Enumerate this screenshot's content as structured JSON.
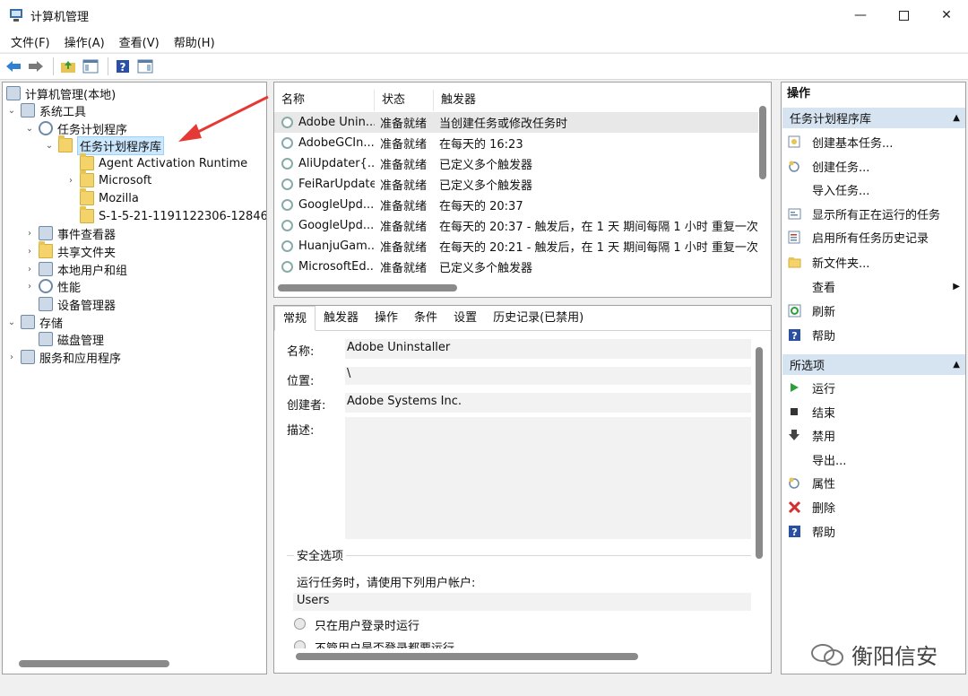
{
  "window": {
    "title": "计算机管理"
  },
  "menu": [
    "文件(F)",
    "操作(A)",
    "查看(V)",
    "帮助(H)"
  ],
  "tree": {
    "root": "计算机管理(本地)",
    "system_tools": "系统工具",
    "task_scheduler": "任务计划程序",
    "task_library": "任务计划程序库",
    "agent": "Agent Activation Runtime",
    "microsoft": "Microsoft",
    "mozilla": "Mozilla",
    "sid": "S-1-5-21-1191122306-12846",
    "event_viewer": "事件查看器",
    "shared_folders": "共享文件夹",
    "local_users": "本地用户和组",
    "performance": "性能",
    "device_manager": "设备管理器",
    "storage": "存储",
    "disk_management": "磁盘管理",
    "services": "服务和应用程序"
  },
  "list": {
    "headers": [
      "名称",
      "状态",
      "触发器"
    ],
    "rows": [
      [
        "Adobe Unin...",
        "准备就绪",
        "当创建任务或修改任务时"
      ],
      [
        "AdobeGCIn...",
        "准备就绪",
        "在每天的 16:23"
      ],
      [
        "AliUpdater{...",
        "准备就绪",
        "已定义多个触发器"
      ],
      [
        "FeiRarUpdate",
        "准备就绪",
        "已定义多个触发器"
      ],
      [
        "GoogleUpd...",
        "准备就绪",
        "在每天的 20:37"
      ],
      [
        "GoogleUpd...",
        "准备就绪",
        "在每天的 20:37 - 触发后，在 1 天 期间每隔 1 小时 重复一次。"
      ],
      [
        "HuanjuGam...",
        "准备就绪",
        "在每天的 20:21 - 触发后，在 1 天 期间每隔 1 小时 重复一次。"
      ],
      [
        "MicrosoftEd...",
        "准备就绪",
        "已定义多个触发器"
      ]
    ]
  },
  "detail": {
    "tabs": [
      "常规",
      "触发器",
      "操作",
      "条件",
      "设置",
      "历史记录(已禁用)"
    ],
    "name_label": "名称:",
    "name_value": "Adobe Uninstaller",
    "location_label": "位置:",
    "location_value": "\\",
    "author_label": "创建者:",
    "author_value": "Adobe Systems Inc.",
    "description_label": "描述:",
    "security_title": "安全选项",
    "run_as_label": "运行任务时，请使用下列用户帐户:",
    "user": "Users",
    "option_logged_on": "只在用户登录时运行",
    "option_whether": "不管用户是否登录都要运行"
  },
  "actions": {
    "title": "操作",
    "section1": "任务计划程序库",
    "items1": [
      "创建基本任务...",
      "创建任务...",
      "导入任务...",
      "显示所有正在运行的任务",
      "启用所有任务历史记录",
      "新文件夹...",
      "查看",
      "刷新",
      "帮助"
    ],
    "section2": "所选项",
    "items2": [
      "运行",
      "结束",
      "禁用",
      "导出...",
      "属性",
      "删除",
      "帮助"
    ]
  },
  "watermark": "衡阳信安",
  "colors": {
    "selection": "#cce8ff",
    "section_bg": "#d6e4f2",
    "arrow": "#e53935"
  }
}
